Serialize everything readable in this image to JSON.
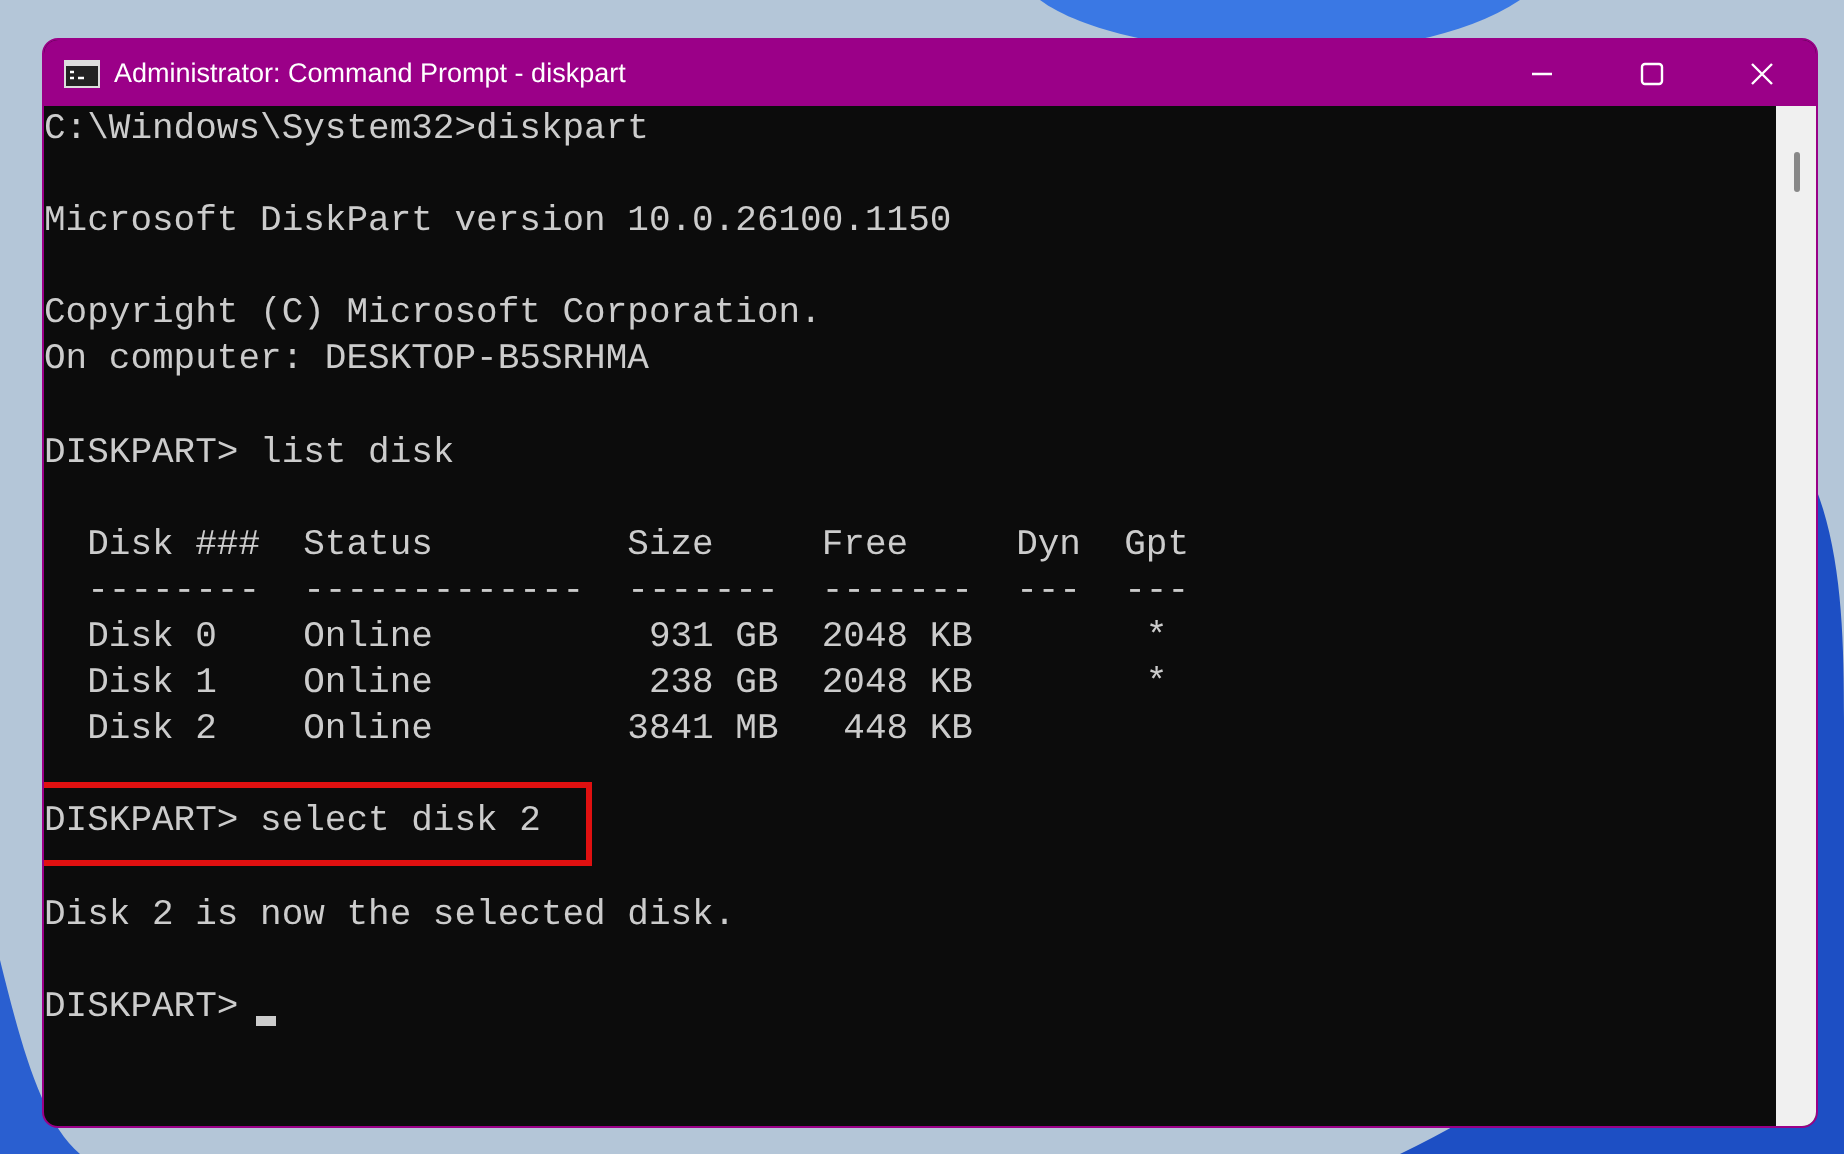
{
  "window": {
    "title": "Administrator: Command Prompt - diskpart"
  },
  "console": {
    "lines": [
      {
        "kind": "text",
        "text": "C:\\Windows\\System32>diskpart",
        "highlighted": false,
        "cursor": false
      },
      {
        "kind": "blank",
        "highlighted": false,
        "cursor": false
      },
      {
        "kind": "text",
        "text": "Microsoft DiskPart version 10.0.26100.1150",
        "highlighted": false,
        "cursor": false
      },
      {
        "kind": "blank",
        "highlighted": false,
        "cursor": false
      },
      {
        "kind": "text",
        "text": "Copyright (C) Microsoft Corporation.",
        "highlighted": false,
        "cursor": false
      },
      {
        "kind": "text",
        "text": "On computer: DESKTOP-B5SRHMA",
        "highlighted": false,
        "cursor": false
      },
      {
        "kind": "blank",
        "highlighted": false,
        "cursor": false
      },
      {
        "kind": "text",
        "text": "DISKPART> list disk",
        "highlighted": false,
        "cursor": false
      },
      {
        "kind": "blank",
        "highlighted": false,
        "cursor": false
      },
      {
        "kind": "text",
        "text": "  Disk ###  Status         Size     Free     Dyn  Gpt",
        "highlighted": false,
        "cursor": false
      },
      {
        "kind": "text",
        "text": "  --------  -------------  -------  -------  ---  ---",
        "highlighted": false,
        "cursor": false
      },
      {
        "kind": "text",
        "text": "  Disk 0    Online          931 GB  2048 KB        *",
        "highlighted": false,
        "cursor": false
      },
      {
        "kind": "text",
        "text": "  Disk 1    Online          238 GB  2048 KB        *",
        "highlighted": false,
        "cursor": false
      },
      {
        "kind": "text",
        "text": "  Disk 2    Online         3841 MB   448 KB",
        "highlighted": false,
        "cursor": false
      },
      {
        "kind": "blank",
        "highlighted": false,
        "cursor": false
      },
      {
        "kind": "text",
        "text": "DISKPART> select disk 2",
        "highlighted": true,
        "cursor": false
      },
      {
        "kind": "blank",
        "highlighted": false,
        "cursor": false
      },
      {
        "kind": "text",
        "text": "Disk 2 is now the selected disk.",
        "highlighted": false,
        "cursor": false
      },
      {
        "kind": "blank",
        "highlighted": false,
        "cursor": false
      },
      {
        "kind": "text",
        "text": "DISKPART> ",
        "highlighted": false,
        "cursor": true
      }
    ]
  }
}
